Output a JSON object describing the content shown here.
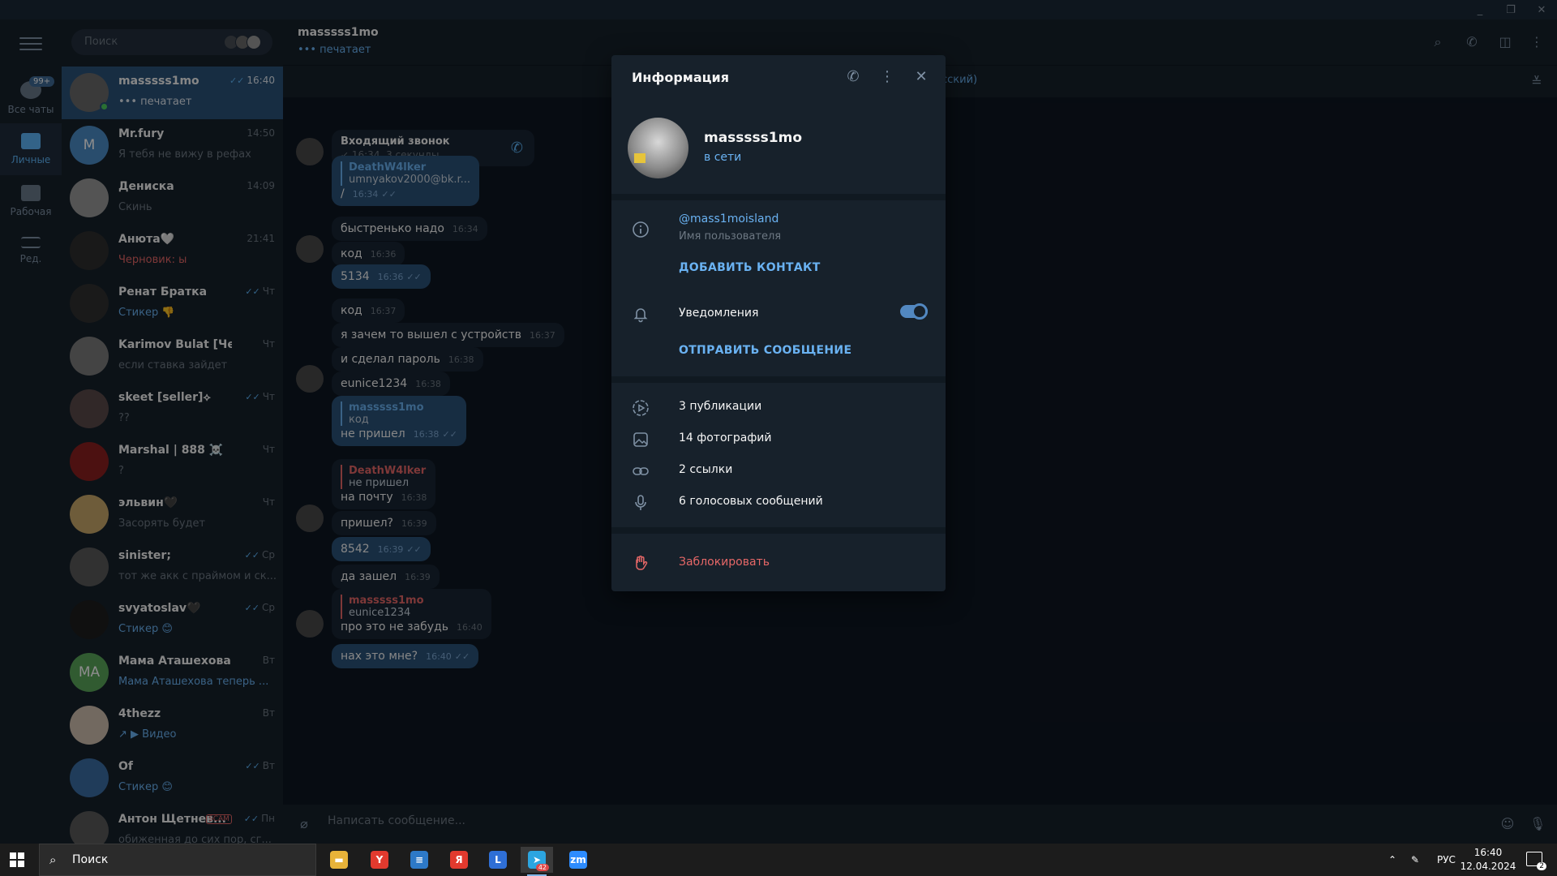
{
  "window": {
    "controls": [
      "_",
      "❐",
      "✕"
    ]
  },
  "folders": {
    "items": [
      {
        "label": "Все чаты",
        "badge": "99+",
        "icon": "chat-bubble-icon"
      },
      {
        "label": "Личные",
        "icon": "folder-icon"
      },
      {
        "label": "Рабочая",
        "icon": "folder-icon"
      },
      {
        "label": "Ред.",
        "icon": "edit-folders-icon"
      }
    ]
  },
  "search": {
    "placeholder": "Поиск"
  },
  "chats": [
    {
      "name": "masssss1mo",
      "time": "16:40",
      "snippet": "••• печатает",
      "read": true,
      "avatar_color": "#6b6b6b",
      "initials": "",
      "snippet_style": "active"
    },
    {
      "name": "Mr.fury",
      "time": "14:50",
      "snippet": "Я тебя не вижу в рефах",
      "avatar_color": "#4c8cc7",
      "initials": "M"
    },
    {
      "name": "Дениска",
      "time": "14:09",
      "snippet": "Скинь",
      "avatar_color": "#9a9a9a",
      "initials": ""
    },
    {
      "name": "Анюта🤍",
      "time": "21:41",
      "snippet": "Черновик: ы",
      "avatar_color": "#2e2e2e",
      "initials": "",
      "snippet_style": "draft"
    },
    {
      "name": "Ренат Братка",
      "time": "Чт",
      "snippet": "Стикер 👎",
      "read": true,
      "avatar_color": "#303030",
      "initials": "",
      "snippet_style": "accent"
    },
    {
      "name": "Karimov Bulat [Чек ...",
      "time": "Чт",
      "snippet": "если ставка зайдет",
      "avatar_color": "#7c7c7c",
      "initials": ""
    },
    {
      "name": "skeet [seller]⟡",
      "time": "Чт",
      "snippet": "??",
      "read": true,
      "avatar_color": "#5a4a4a",
      "initials": ""
    },
    {
      "name": "Marshal | 888 ☠️",
      "time": "Чт",
      "snippet": "?",
      "avatar_color": "#8a2020",
      "initials": ""
    },
    {
      "name": "эльвин🖤",
      "time": "Чт",
      "snippet": "Засорять будет",
      "avatar_color": "#c9a86a",
      "initials": ""
    },
    {
      "name": "sinister;",
      "time": "Ср",
      "snippet": "тот же акк с праймом и ск...",
      "read": true,
      "avatar_color": "#5a5a5a",
      "initials": ""
    },
    {
      "name": "svyatoslav🖤",
      "time": "Ср",
      "snippet": "Стикер 😊",
      "read": true,
      "avatar_color": "#1e1e1e",
      "initials": "",
      "snippet_style": "accent"
    },
    {
      "name": "Мама Аташехова",
      "time": "Вт",
      "snippet": "Мама Аташехова теперь ...",
      "avatar_color": "#5aa65a",
      "initials": "MA",
      "snippet_style": "accent"
    },
    {
      "name": "4thezz",
      "time": "Вт",
      "snippet": "↗ ▶ Видео",
      "avatar_color": "#d0c0b0",
      "initials": "",
      "snippet_style": "accent"
    },
    {
      "name": "Of",
      "time": "Вт",
      "snippet": "Стикер 😊",
      "read": true,
      "avatar_color": "#3b6ea5",
      "initials": "",
      "snippet_style": "accent"
    },
    {
      "name": "Антон Щетнев...",
      "time": "Пн",
      "snippet": "обиженная до сих пор, сг...",
      "read": true,
      "avatar_color": "#5a5a5a",
      "initials": "",
      "scam": "SCAM"
    }
  ],
  "conversation": {
    "peer": "masssss1mo",
    "status": "••• печатает",
    "pinned_fragment": "сский)",
    "composer_placeholder": "Написать сообщение...",
    "messages": [
      {
        "kind": "call",
        "title": "Входящий звонок",
        "meta": "↙ 16:34, 3 секунды"
      },
      {
        "kind": "out",
        "reply_name": "DeathW4lker",
        "reply_text": "umnyakov2000@bk.r...",
        "text": "/",
        "time": "16:34"
      },
      {
        "kind": "in",
        "text": "быстренько надо",
        "time": "16:34"
      },
      {
        "kind": "in",
        "text": "код",
        "time": "16:36"
      },
      {
        "kind": "out",
        "text": "5134",
        "time": "16:36"
      },
      {
        "kind": "in",
        "text": "код",
        "time": "16:37"
      },
      {
        "kind": "in",
        "text": "я зачем то вышел с устройств",
        "time": "16:37"
      },
      {
        "kind": "in",
        "text": "и сделал пароль",
        "time": "16:38"
      },
      {
        "kind": "in",
        "text": "eunice1234",
        "time": "16:38"
      },
      {
        "kind": "out",
        "reply_name": "masssss1mo",
        "reply_text": "код",
        "text": "не пришел",
        "time": "16:38"
      },
      {
        "kind": "in",
        "reply_name": "DeathW4lker",
        "reply_text": "не пришел",
        "text": "на почту",
        "time": "16:38"
      },
      {
        "kind": "in",
        "text": "пришел?",
        "time": "16:39"
      },
      {
        "kind": "out",
        "text": "8542",
        "time": "16:39"
      },
      {
        "kind": "in",
        "text": "да зашел",
        "time": "16:39"
      },
      {
        "kind": "in",
        "reply_name": "masssss1mo",
        "reply_text": "eunice1234",
        "text": "про это не забудь",
        "time": "16:40"
      },
      {
        "kind": "out",
        "text": "нах это мне?",
        "time": "16:40"
      }
    ]
  },
  "info_panel": {
    "title": "Информация",
    "name": "masssss1mo",
    "status": "в сети",
    "username": "@mass1moisland",
    "username_label": "Имя пользователя",
    "add_contact": "ДОБАВИТЬ КОНТАКТ",
    "notifications_label": "Уведомления",
    "notifications_on": true,
    "send_message": "ОТПРАВИТЬ СООБЩЕНИЕ",
    "media": [
      {
        "label": "3 публикации",
        "icon": "stories-icon"
      },
      {
        "label": "14 фотографий",
        "icon": "photo-icon"
      },
      {
        "label": "2 ссылки",
        "icon": "link-icon"
      },
      {
        "label": "6 голосовых сообщений",
        "icon": "microphone-icon"
      }
    ],
    "block": "Заблокировать"
  },
  "taskbar": {
    "search_label": "Поиск",
    "apps": [
      {
        "name": "explorer",
        "glyph": "▬",
        "color": "#e8b339"
      },
      {
        "name": "yandex-browser",
        "glyph": "Y",
        "color": "#e23a2e"
      },
      {
        "name": "notepad",
        "glyph": "≡",
        "color": "#2d79c7"
      },
      {
        "name": "yandex",
        "glyph": "Я",
        "color": "#e23a2e"
      },
      {
        "name": "lightshot",
        "glyph": "L",
        "color": "#2f6fd6"
      },
      {
        "name": "telegram",
        "glyph": "➤",
        "color": "#2ca5e0",
        "badge": "42",
        "active": true
      },
      {
        "name": "zoom",
        "glyph": "zm",
        "color": "#2d8cff"
      }
    ],
    "language": "РУС",
    "time": "16:40",
    "date": "12.04.2024",
    "notifications": "2"
  }
}
